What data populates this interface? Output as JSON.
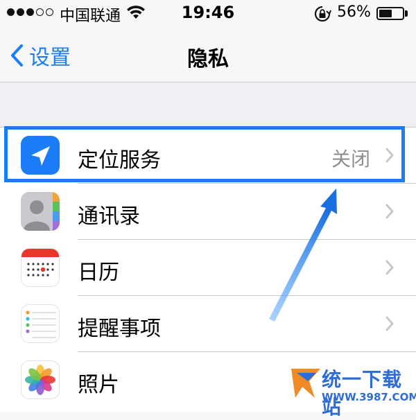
{
  "status_bar": {
    "signal_filled": 3,
    "signal_total": 5,
    "carrier": "中国联通",
    "time": "19:46",
    "battery_pct": "56%",
    "battery_level": 0.56,
    "icons": [
      "signal-dots",
      "wifi-icon",
      "orientation-lock-icon",
      "battery-icon"
    ]
  },
  "nav": {
    "back_label": "设置",
    "title": "隐私"
  },
  "rows": [
    {
      "label": "定位服务",
      "value": "关闭",
      "icon": "location-services-icon",
      "color": "#1a7cf6"
    },
    {
      "label": "通讯录",
      "value": "",
      "icon": "contacts-icon",
      "color": "#8e8e93"
    },
    {
      "label": "日历",
      "value": "",
      "icon": "calendar-icon",
      "color": "#e8362c"
    },
    {
      "label": "提醒事项",
      "value": "",
      "icon": "reminders-icon",
      "color": "#ffffff"
    },
    {
      "label": "照片",
      "value": "",
      "icon": "photos-icon",
      "color": "#ffffff"
    }
  ],
  "watermark": {
    "name": "统一下载站",
    "url": "WWW.3987.COM"
  },
  "colors": {
    "accent": "#1a7cf6",
    "separator": "#c8c7cc",
    "secondary_text": "#8e8e93"
  }
}
